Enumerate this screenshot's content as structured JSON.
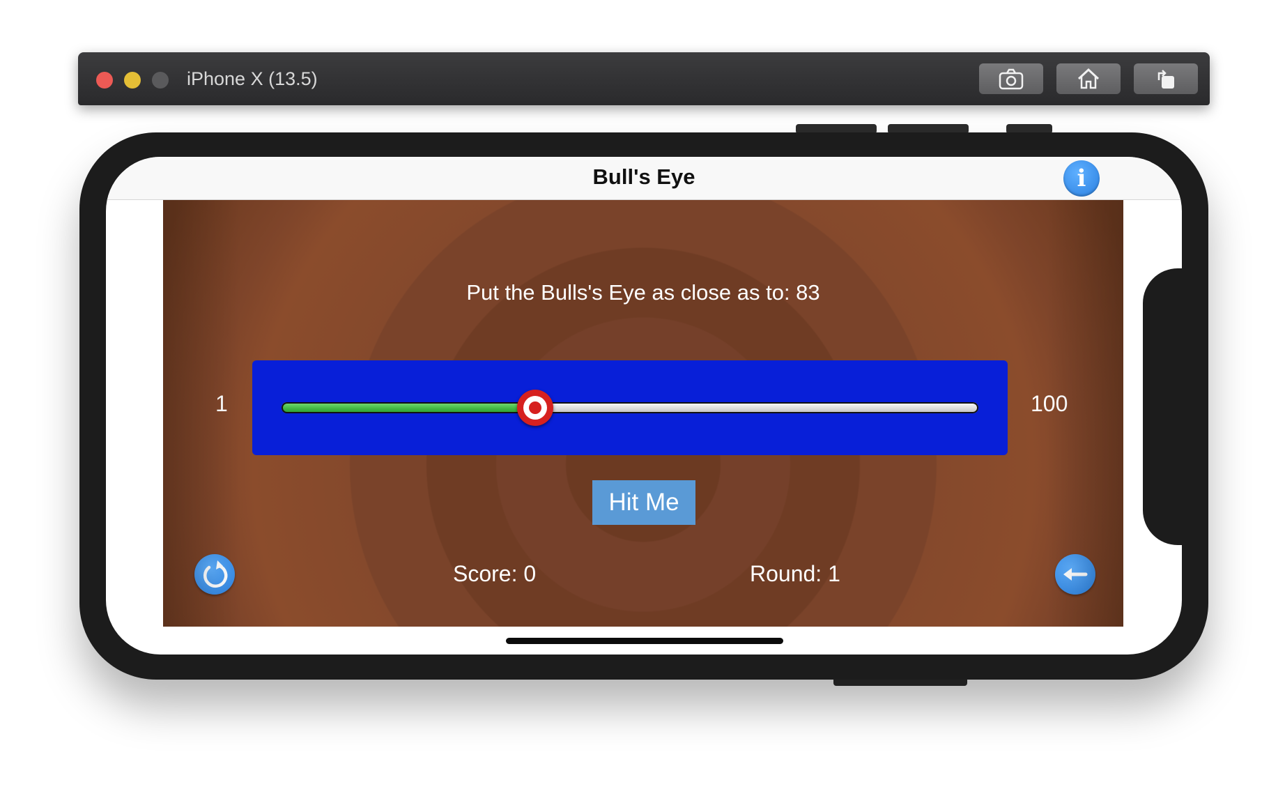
{
  "simulator": {
    "title": "iPhone X (13.5)",
    "buttons": [
      "screenshot-icon",
      "home-icon",
      "rotate-icon"
    ]
  },
  "app": {
    "nav_title": "Bull's Eye",
    "info_label": "i"
  },
  "game": {
    "target_text": "Put the Bulls's Eye as close as to: 83",
    "slider": {
      "min_label": "1",
      "max_label": "100",
      "min": 1,
      "max": 100,
      "value": 37
    },
    "hit_button": "Hit Me",
    "score_text": "Score: 0",
    "round_text": "Round: 1",
    "start_over_icon": "refresh-icon",
    "back_icon": "arrow-left-icon"
  },
  "colors": {
    "slider_panel": "#081fd8",
    "hit_button": "#5a9ad6",
    "accent_blue": "#2b7fdc",
    "thumb_red": "#d6211f",
    "fill_green": "#3fb641"
  }
}
